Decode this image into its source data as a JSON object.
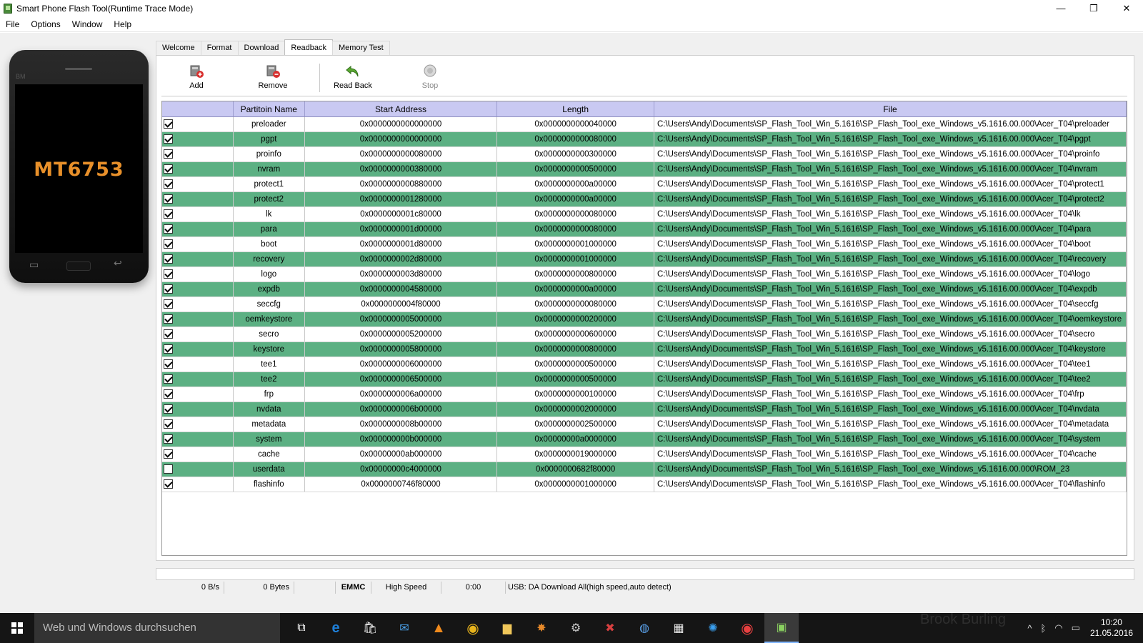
{
  "window": {
    "title": "Smart Phone Flash Tool(Runtime Trace Mode)",
    "minimize": "—",
    "restore": "❐",
    "close": "✕"
  },
  "menu": [
    "File",
    "Options",
    "Window",
    "Help"
  ],
  "phone": {
    "brand": "BM",
    "chip": "MT6753"
  },
  "tabs": [
    {
      "label": "Welcome"
    },
    {
      "label": "Format"
    },
    {
      "label": "Download"
    },
    {
      "label": "Readback",
      "active": true
    },
    {
      "label": "Memory Test"
    }
  ],
  "toolbar": {
    "add": "Add",
    "remove": "Remove",
    "readback": "Read Back",
    "stop": "Stop"
  },
  "table": {
    "headers": [
      "",
      "Partitoin Name",
      "Start Address",
      "Length",
      "File"
    ],
    "rows": [
      {
        "checked": true,
        "name": "preloader",
        "start": "0x0000000000000000",
        "length": "0x0000000000040000",
        "file": "C:\\Users\\Andy\\Documents\\SP_Flash_Tool_Win_5.1616\\SP_Flash_Tool_exe_Windows_v5.1616.00.000\\Acer_T04\\preloader"
      },
      {
        "checked": true,
        "name": "pgpt",
        "start": "0x0000000000000000",
        "length": "0x0000000000080000",
        "file": "C:\\Users\\Andy\\Documents\\SP_Flash_Tool_Win_5.1616\\SP_Flash_Tool_exe_Windows_v5.1616.00.000\\Acer_T04\\pgpt"
      },
      {
        "checked": true,
        "name": "proinfo",
        "start": "0x0000000000080000",
        "length": "0x0000000000300000",
        "file": "C:\\Users\\Andy\\Documents\\SP_Flash_Tool_Win_5.1616\\SP_Flash_Tool_exe_Windows_v5.1616.00.000\\Acer_T04\\proinfo"
      },
      {
        "checked": true,
        "name": "nvram",
        "start": "0x0000000000380000",
        "length": "0x0000000000500000",
        "file": "C:\\Users\\Andy\\Documents\\SP_Flash_Tool_Win_5.1616\\SP_Flash_Tool_exe_Windows_v5.1616.00.000\\Acer_T04\\nvram"
      },
      {
        "checked": true,
        "name": "protect1",
        "start": "0x0000000000880000",
        "length": "0x0000000000a00000",
        "file": "C:\\Users\\Andy\\Documents\\SP_Flash_Tool_Win_5.1616\\SP_Flash_Tool_exe_Windows_v5.1616.00.000\\Acer_T04\\protect1"
      },
      {
        "checked": true,
        "name": "protect2",
        "start": "0x0000000001280000",
        "length": "0x0000000000a00000",
        "file": "C:\\Users\\Andy\\Documents\\SP_Flash_Tool_Win_5.1616\\SP_Flash_Tool_exe_Windows_v5.1616.00.000\\Acer_T04\\protect2"
      },
      {
        "checked": true,
        "name": "lk",
        "start": "0x0000000001c80000",
        "length": "0x0000000000080000",
        "file": "C:\\Users\\Andy\\Documents\\SP_Flash_Tool_Win_5.1616\\SP_Flash_Tool_exe_Windows_v5.1616.00.000\\Acer_T04\\lk"
      },
      {
        "checked": true,
        "name": "para",
        "start": "0x0000000001d00000",
        "length": "0x0000000000080000",
        "file": "C:\\Users\\Andy\\Documents\\SP_Flash_Tool_Win_5.1616\\SP_Flash_Tool_exe_Windows_v5.1616.00.000\\Acer_T04\\para"
      },
      {
        "checked": true,
        "name": "boot",
        "start": "0x0000000001d80000",
        "length": "0x0000000001000000",
        "file": "C:\\Users\\Andy\\Documents\\SP_Flash_Tool_Win_5.1616\\SP_Flash_Tool_exe_Windows_v5.1616.00.000\\Acer_T04\\boot"
      },
      {
        "checked": true,
        "name": "recovery",
        "start": "0x0000000002d80000",
        "length": "0x0000000001000000",
        "file": "C:\\Users\\Andy\\Documents\\SP_Flash_Tool_Win_5.1616\\SP_Flash_Tool_exe_Windows_v5.1616.00.000\\Acer_T04\\recovery"
      },
      {
        "checked": true,
        "name": "logo",
        "start": "0x0000000003d80000",
        "length": "0x0000000000800000",
        "file": "C:\\Users\\Andy\\Documents\\SP_Flash_Tool_Win_5.1616\\SP_Flash_Tool_exe_Windows_v5.1616.00.000\\Acer_T04\\logo"
      },
      {
        "checked": true,
        "name": "expdb",
        "start": "0x0000000004580000",
        "length": "0x0000000000a00000",
        "file": "C:\\Users\\Andy\\Documents\\SP_Flash_Tool_Win_5.1616\\SP_Flash_Tool_exe_Windows_v5.1616.00.000\\Acer_T04\\expdb"
      },
      {
        "checked": true,
        "name": "seccfg",
        "start": "0x0000000004f80000",
        "length": "0x0000000000080000",
        "file": "C:\\Users\\Andy\\Documents\\SP_Flash_Tool_Win_5.1616\\SP_Flash_Tool_exe_Windows_v5.1616.00.000\\Acer_T04\\seccfg"
      },
      {
        "checked": true,
        "name": "oemkeystore",
        "start": "0x0000000005000000",
        "length": "0x0000000000200000",
        "file": "C:\\Users\\Andy\\Documents\\SP_Flash_Tool_Win_5.1616\\SP_Flash_Tool_exe_Windows_v5.1616.00.000\\Acer_T04\\oemkeystore"
      },
      {
        "checked": true,
        "name": "secro",
        "start": "0x0000000005200000",
        "length": "0x0000000000600000",
        "file": "C:\\Users\\Andy\\Documents\\SP_Flash_Tool_Win_5.1616\\SP_Flash_Tool_exe_Windows_v5.1616.00.000\\Acer_T04\\secro"
      },
      {
        "checked": true,
        "name": "keystore",
        "start": "0x0000000005800000",
        "length": "0x0000000000800000",
        "file": "C:\\Users\\Andy\\Documents\\SP_Flash_Tool_Win_5.1616\\SP_Flash_Tool_exe_Windows_v5.1616.00.000\\Acer_T04\\keystore"
      },
      {
        "checked": true,
        "name": "tee1",
        "start": "0x0000000006000000",
        "length": "0x0000000000500000",
        "file": "C:\\Users\\Andy\\Documents\\SP_Flash_Tool_Win_5.1616\\SP_Flash_Tool_exe_Windows_v5.1616.00.000\\Acer_T04\\tee1"
      },
      {
        "checked": true,
        "name": "tee2",
        "start": "0x0000000006500000",
        "length": "0x0000000000500000",
        "file": "C:\\Users\\Andy\\Documents\\SP_Flash_Tool_Win_5.1616\\SP_Flash_Tool_exe_Windows_v5.1616.00.000\\Acer_T04\\tee2"
      },
      {
        "checked": true,
        "name": "frp",
        "start": "0x0000000006a00000",
        "length": "0x0000000000100000",
        "file": "C:\\Users\\Andy\\Documents\\SP_Flash_Tool_Win_5.1616\\SP_Flash_Tool_exe_Windows_v5.1616.00.000\\Acer_T04\\frp"
      },
      {
        "checked": true,
        "name": "nvdata",
        "start": "0x0000000006b00000",
        "length": "0x0000000002000000",
        "file": "C:\\Users\\Andy\\Documents\\SP_Flash_Tool_Win_5.1616\\SP_Flash_Tool_exe_Windows_v5.1616.00.000\\Acer_T04\\nvdata"
      },
      {
        "checked": true,
        "name": "metadata",
        "start": "0x0000000008b00000",
        "length": "0x0000000002500000",
        "file": "C:\\Users\\Andy\\Documents\\SP_Flash_Tool_Win_5.1616\\SP_Flash_Tool_exe_Windows_v5.1616.00.000\\Acer_T04\\metadata"
      },
      {
        "checked": true,
        "name": "system",
        "start": "0x000000000b000000",
        "length": "0x00000000a0000000",
        "file": "C:\\Users\\Andy\\Documents\\SP_Flash_Tool_Win_5.1616\\SP_Flash_Tool_exe_Windows_v5.1616.00.000\\Acer_T04\\system"
      },
      {
        "checked": true,
        "name": "cache",
        "start": "0x00000000ab000000",
        "length": "0x0000000019000000",
        "file": "C:\\Users\\Andy\\Documents\\SP_Flash_Tool_Win_5.1616\\SP_Flash_Tool_exe_Windows_v5.1616.00.000\\Acer_T04\\cache"
      },
      {
        "checked": false,
        "name": "userdata",
        "start": "0x00000000c4000000",
        "length": "0x0000000682f80000",
        "file": "C:\\Users\\Andy\\Documents\\SP_Flash_Tool_Win_5.1616\\SP_Flash_Tool_exe_Windows_v5.1616.00.000\\ROM_23"
      },
      {
        "checked": true,
        "name": "flashinfo",
        "start": "0x0000000746f80000",
        "length": "0x0000000001000000",
        "file": "C:\\Users\\Andy\\Documents\\SP_Flash_Tool_Win_5.1616\\SP_Flash_Tool_exe_Windows_v5.1616.00.000\\Acer_T04\\flashinfo"
      }
    ]
  },
  "status": {
    "speed": "0 B/s",
    "bytes": "0 Bytes",
    "storage": "EMMC",
    "mode": "High Speed",
    "time": "0:00",
    "usb": "USB: DA Download All(high speed,auto detect)"
  },
  "taskbar": {
    "search_placeholder": "Web und Windows durchsuchen",
    "time": "10:20",
    "date": "21.05.2016",
    "watermark": "Brook Burling"
  },
  "colors": {
    "highlight_row": "#5cb083",
    "header_bg": "#c9c9f2",
    "chip_text": "#e8902a"
  }
}
